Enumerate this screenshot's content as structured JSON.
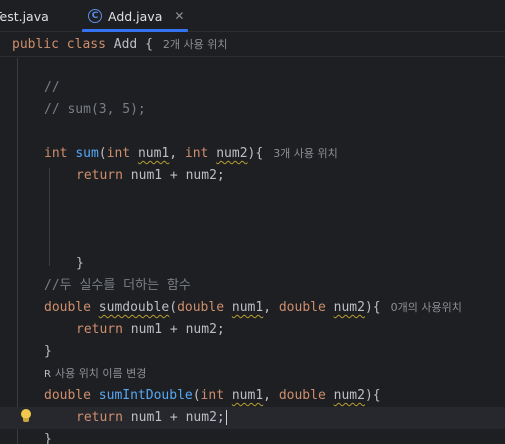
{
  "tabs": [
    {
      "label": "Test.java"
    },
    {
      "label": "Add.java",
      "icon": "class-icon",
      "icon_glyph": "C",
      "close": "✕",
      "active": true
    }
  ],
  "sticky_header": {
    "kw1": "public",
    "kw2": "class",
    "name": "Add",
    "brace": "{",
    "hint": "2개 사용 위치"
  },
  "code": {
    "c1": "//",
    "c2": "// sum(3, 5);",
    "sum_kw": "int",
    "sum_name": "sum",
    "sum_p1_type": "int",
    "sum_p1": "num1",
    "sum_p2_type": "int",
    "sum_p2": "num2",
    "sum_open": "){",
    "sum_hint": "3개 사용 위치",
    "sum_ret_kw": "return",
    "sum_ret_expr": "num1 + num2;",
    "close_brace": "}",
    "c3": "//두 실수를 더하는 함수",
    "sd_kw": "double",
    "sd_name": "sumdouble",
    "sd_p1_type": "double",
    "sd_p1": "num1",
    "sd_p2_type": "double",
    "sd_p2": "num2",
    "sd_hint": "0개의 사용위치",
    "sd_ret_kw": "return",
    "sd_ret_expr": "num1 + num2;",
    "rename_hint": "사용 위치 이름 변경",
    "sid_kw": "double",
    "sid_name": "sumIntDouble",
    "sid_p1_type": "int",
    "sid_p1": "num1",
    "sid_p2_type": "double",
    "sid_p2": "num2",
    "sid_ret_kw": "return",
    "sid_ret_expr": "num1 + num2;"
  },
  "colors": {
    "keyword": "#cf8e6d",
    "function": "#56a8f5",
    "comment": "#7a7e85",
    "accent": "#3574f0"
  }
}
